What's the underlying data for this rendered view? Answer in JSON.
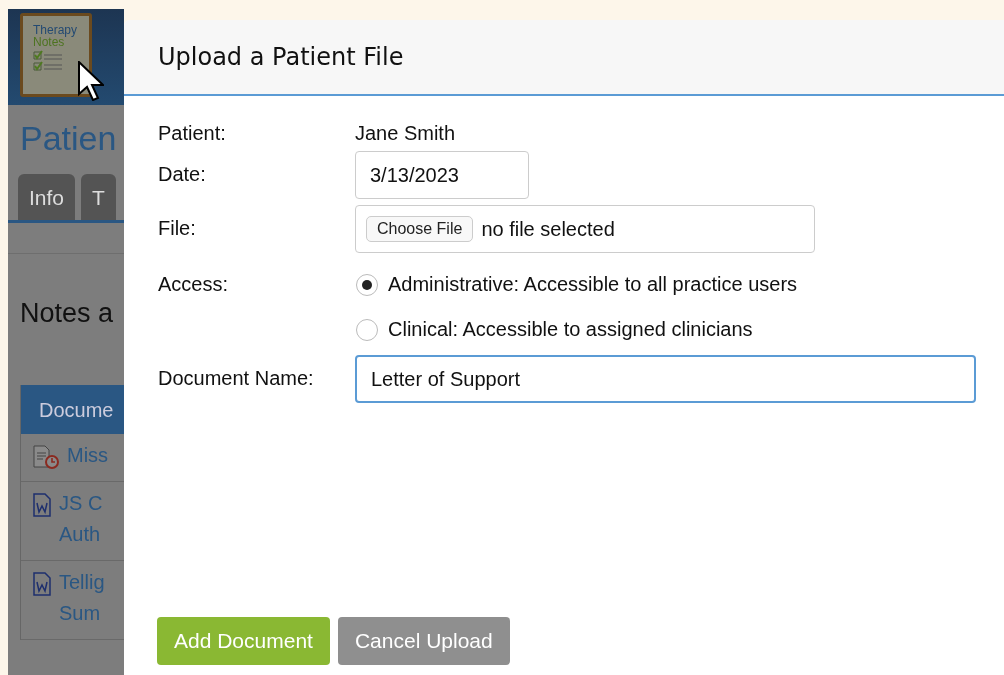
{
  "background": {
    "logo": {
      "line_1": "Therapy",
      "line_2": "Notes"
    },
    "heading": "Patien",
    "tabs": [
      "Info",
      "T"
    ],
    "section_title": "Notes a",
    "table": {
      "header": "Docume",
      "rows": [
        {
          "kind": "missing",
          "lines": [
            "Miss"
          ]
        },
        {
          "kind": "word",
          "lines": [
            "JS C",
            "Auth"
          ]
        },
        {
          "kind": "word",
          "lines": [
            "Tellig",
            "Sum"
          ]
        }
      ]
    }
  },
  "dialog": {
    "title": "Upload a Patient File",
    "patient": {
      "label": "Patient:",
      "value": "Jane Smith"
    },
    "date": {
      "label": "Date:",
      "value": "3/13/2023"
    },
    "file": {
      "label": "File:",
      "button": "Choose File",
      "status": "no file selected"
    },
    "access": {
      "label": "Access:",
      "options": [
        {
          "label": "Administrative: Accessible to all practice users",
          "selected": true
        },
        {
          "label": "Clinical: Accessible to assigned clinicians",
          "selected": false
        }
      ]
    },
    "document_name": {
      "label": "Document Name:",
      "value": "Letter of Support",
      "focused": true
    },
    "buttons": [
      {
        "label": "Add Document",
        "kind": "primary"
      },
      {
        "label": "Cancel Upload",
        "kind": "secondary"
      }
    ]
  }
}
